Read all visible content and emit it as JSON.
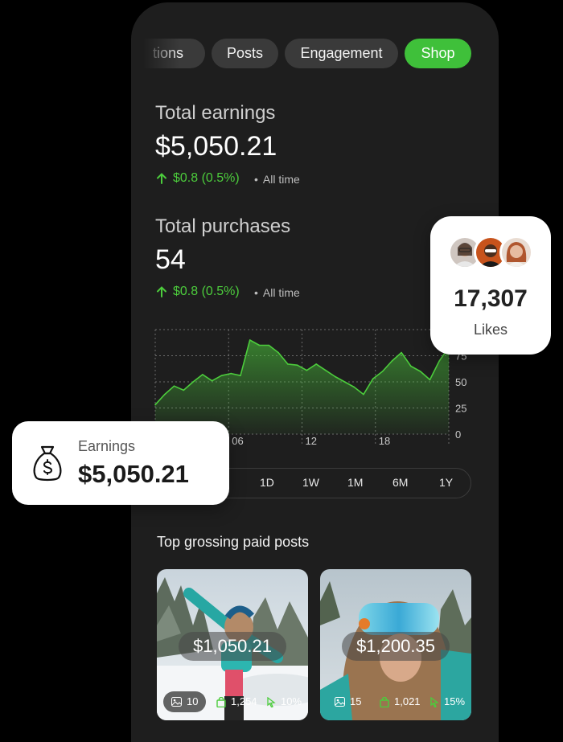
{
  "tabs": [
    {
      "label": "tions",
      "active": false
    },
    {
      "label": "Posts",
      "active": false
    },
    {
      "label": "Engagement",
      "active": false
    },
    {
      "label": "Shop",
      "active": true
    }
  ],
  "earnings": {
    "title": "Total earnings",
    "value": "$5,050.21",
    "change": "$0.8 (0.5%)",
    "period": "All time"
  },
  "purchases": {
    "title": "Total purchases",
    "value": "54",
    "change": "$0.8 (0.5%)",
    "period": "All time"
  },
  "chart_data": {
    "type": "area",
    "x": [
      0,
      1,
      2,
      3,
      4,
      5,
      6,
      7,
      8,
      9,
      10,
      11,
      12,
      13,
      14,
      15,
      16,
      17,
      18,
      19,
      20,
      21,
      22,
      23,
      24,
      25,
      26,
      27,
      28,
      29,
      30,
      31
    ],
    "values": [
      28,
      38,
      46,
      42,
      50,
      57,
      51,
      56,
      58,
      56,
      90,
      85,
      85,
      78,
      67,
      66,
      61,
      67,
      61,
      55,
      50,
      45,
      38,
      53,
      60,
      70,
      78,
      65,
      60,
      52,
      70,
      83
    ],
    "y_ticks": [
      "0",
      "25",
      "50",
      "75"
    ],
    "x_ticks": [
      "06",
      "12",
      "18"
    ],
    "ylim": [
      0,
      100
    ],
    "color": "#4ccc3c",
    "grid": true
  },
  "range": {
    "options": [
      "1D",
      "1W",
      "1M",
      "6M",
      "1Y"
    ]
  },
  "top_posts": {
    "title": "Top grossing paid posts",
    "items": [
      {
        "price": "$1,050.21",
        "media_count": "10",
        "purchases": "1,254",
        "rate": "10%"
      },
      {
        "price": "$1,200.35",
        "media_count": "15",
        "purchases": "1,021",
        "rate": "15%"
      }
    ]
  },
  "likes_card": {
    "value": "17,307",
    "label": "Likes"
  },
  "earnings_card": {
    "label": "Earnings",
    "value": "$5,050.21"
  },
  "colors": {
    "accent": "#3fc03a",
    "background": "#1e1e1e"
  }
}
